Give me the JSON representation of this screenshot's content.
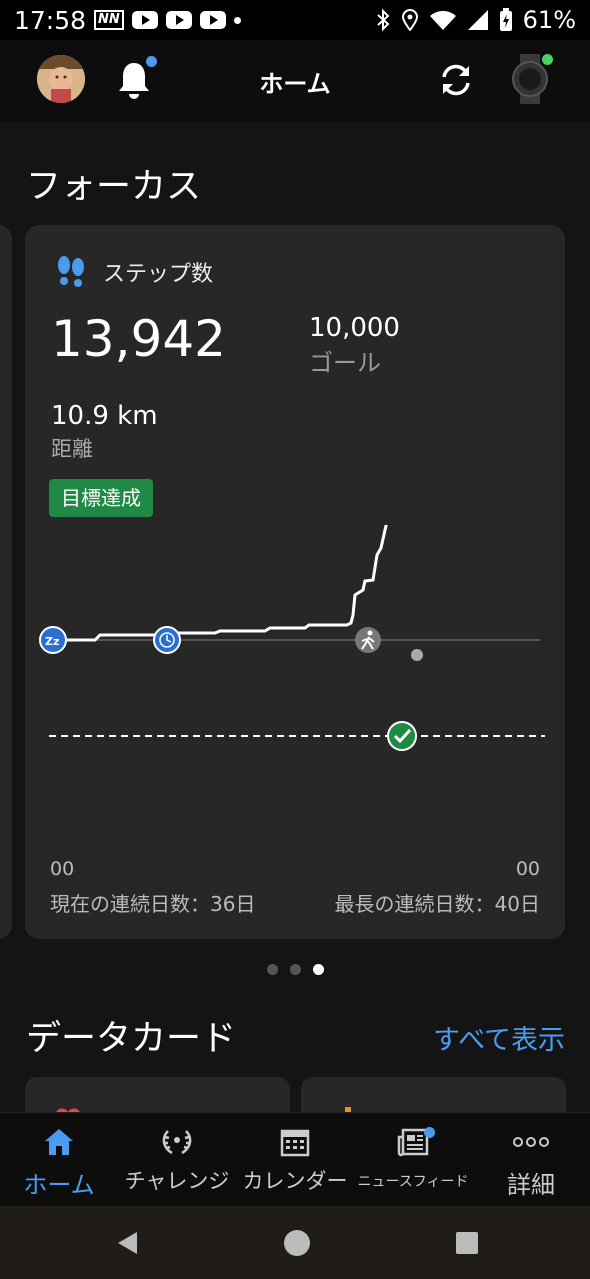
{
  "status_bar": {
    "time": "17:58",
    "battery": "61%"
  },
  "header": {
    "title": "ホーム"
  },
  "focus": {
    "title": "フォーカス",
    "card": {
      "title": "ステップ数",
      "steps": "13,942",
      "goal_value": "10,000",
      "goal_label": "ゴール",
      "distance_value": "10.9 km",
      "distance_label": "距離",
      "badge": "目標達成",
      "axis_start": "00",
      "axis_end": "00",
      "current_streak": "現在の連続日数：36日",
      "longest_streak": "最長の連続日数：40日"
    },
    "pager": {
      "count": 3,
      "active": 2
    }
  },
  "data_cards": {
    "title": "データカード",
    "show_all": "すべて表示"
  },
  "bottom_nav": {
    "items": [
      {
        "label": "ホーム",
        "icon": "home-icon",
        "active": true
      },
      {
        "label": "チャレンジ",
        "icon": "laurel-icon",
        "active": false
      },
      {
        "label": "カレンダー",
        "icon": "calendar-icon",
        "active": false
      },
      {
        "label": "ニュースフィード",
        "icon": "newsfeed-icon",
        "active": false
      },
      {
        "label": "詳細",
        "icon": "more-icon",
        "active": false
      }
    ]
  },
  "colors": {
    "accent": "#4b9cf0",
    "goal_green": "#1e8a44",
    "card_bg": "#272727"
  }
}
